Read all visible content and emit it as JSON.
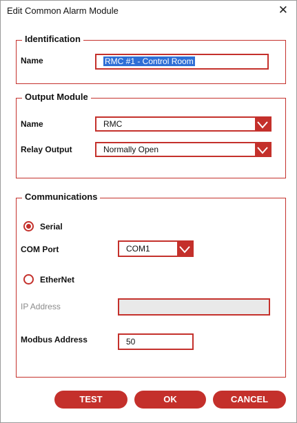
{
  "window": {
    "title": "Edit Common Alarm Module",
    "close_glyph": "✕"
  },
  "identification": {
    "legend": "Identification",
    "name_label": "Name",
    "name_value": "RMC #1 - Control Room"
  },
  "output_module": {
    "legend": "Output Module",
    "name_label": "Name",
    "name_value": "RMC",
    "relay_label": "Relay Output",
    "relay_value": "Normally Open"
  },
  "communications": {
    "legend": "Communications",
    "serial_label": "Serial",
    "serial_checked": true,
    "com_port_label": "COM Port",
    "com_port_value": "COM1",
    "ethernet_label": "EtherNet",
    "ethernet_checked": false,
    "ip_label": "IP Address",
    "ip_value": "",
    "modbus_label": "Modbus Address",
    "modbus_value": "50"
  },
  "buttons": {
    "test": "TEST",
    "ok": "OK",
    "cancel": "CANCEL"
  },
  "icons": {
    "close": "close-icon",
    "dropdown": "chevron-down-icon"
  },
  "colors": {
    "accent": "#c4302b",
    "selection": "#2f6fd6",
    "disabled_bg": "#e9e9e9"
  }
}
